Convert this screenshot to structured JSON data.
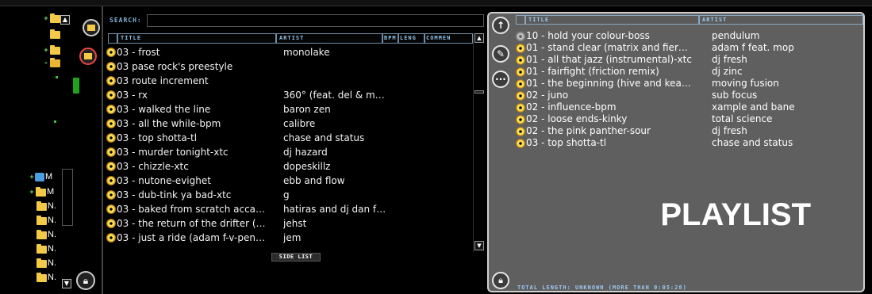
{
  "search": {
    "label": "SEARCH:",
    "value": ""
  },
  "library": {
    "columns": [
      "TITLE",
      "ARTIST",
      "BPM",
      "LENG",
      "COMMEN"
    ],
    "rows": [
      {
        "title": "03 - frost",
        "artist": "monolake",
        "cd": "on"
      },
      {
        "title": "03 pase rock's preestyle",
        "artist": "",
        "cd": "on"
      },
      {
        "title": "03 route increment",
        "artist": "",
        "cd": "on"
      },
      {
        "title": "03 - rx",
        "artist": "360° (feat. del & m…",
        "cd": "on"
      },
      {
        "title": "03 - walked the line",
        "artist": "baron zen",
        "cd": "on"
      },
      {
        "title": "03 - all the while-bpm",
        "artist": "calibre",
        "cd": "on"
      },
      {
        "title": "03 - top shotta-tl",
        "artist": "chase and status",
        "cd": "on"
      },
      {
        "title": "03 - murder tonight-xtc",
        "artist": "dj hazard",
        "cd": "on"
      },
      {
        "title": "03 - chizzle-xtc",
        "artist": "dopeskillz",
        "cd": "on"
      },
      {
        "title": "03 - nutone-evighet",
        "artist": "ebb and flow",
        "cd": "on"
      },
      {
        "title": "03 - dub-tink ya bad-xtc",
        "artist": "g",
        "cd": "on"
      },
      {
        "title": "03 - baked from scratch  acca…",
        "artist": "hatiras and dj dan f…",
        "cd": "on"
      },
      {
        "title": "03 - the return of the drifter (…",
        "artist": "jehst",
        "cd": "on"
      },
      {
        "title": "03 - just a ride (adam f-v-pen…",
        "artist": "jem",
        "cd": "on"
      }
    ],
    "side_list_label": "SIDE LIST"
  },
  "tree": {
    "items": [
      {
        "label": "M"
      },
      {
        "label": "M"
      },
      {
        "label": "N."
      },
      {
        "label": "N."
      },
      {
        "label": "N."
      },
      {
        "label": "N."
      },
      {
        "label": "N."
      },
      {
        "label": "N."
      }
    ]
  },
  "playlist": {
    "columns": [
      "TITLE",
      "ARTIST"
    ],
    "rows": [
      {
        "title": "10 - hold your colour-boss",
        "artist": "pendulum",
        "cd": "off"
      },
      {
        "title": "01 - stand clear (matrix and fier…",
        "artist": "adam f feat. mop",
        "cd": "on"
      },
      {
        "title": "01 - all that jazz (instrumental)-xtc",
        "artist": "dj fresh",
        "cd": "on"
      },
      {
        "title": "01 - fairfight (friction remix)",
        "artist": "dj zinc",
        "cd": "on"
      },
      {
        "title": "01 - the beginning (hive and kea…",
        "artist": "moving fusion",
        "cd": "on"
      },
      {
        "title": "02 - juno",
        "artist": "sub focus",
        "cd": "on"
      },
      {
        "title": "02 - influence-bpm",
        "artist": "xample and bane",
        "cd": "on"
      },
      {
        "title": "02 - loose ends-kinky",
        "artist": "total science",
        "cd": "on"
      },
      {
        "title": "02 - the pink panther-sour",
        "artist": "dj fresh",
        "cd": "on"
      },
      {
        "title": "03 - top shotta-tl",
        "artist": "chase and status",
        "cd": "on"
      }
    ],
    "watermark": "PLAYLIST",
    "total_length": "TOTAL LENGTH: UNKNOWN (MORE THAN 0:05:28)"
  }
}
